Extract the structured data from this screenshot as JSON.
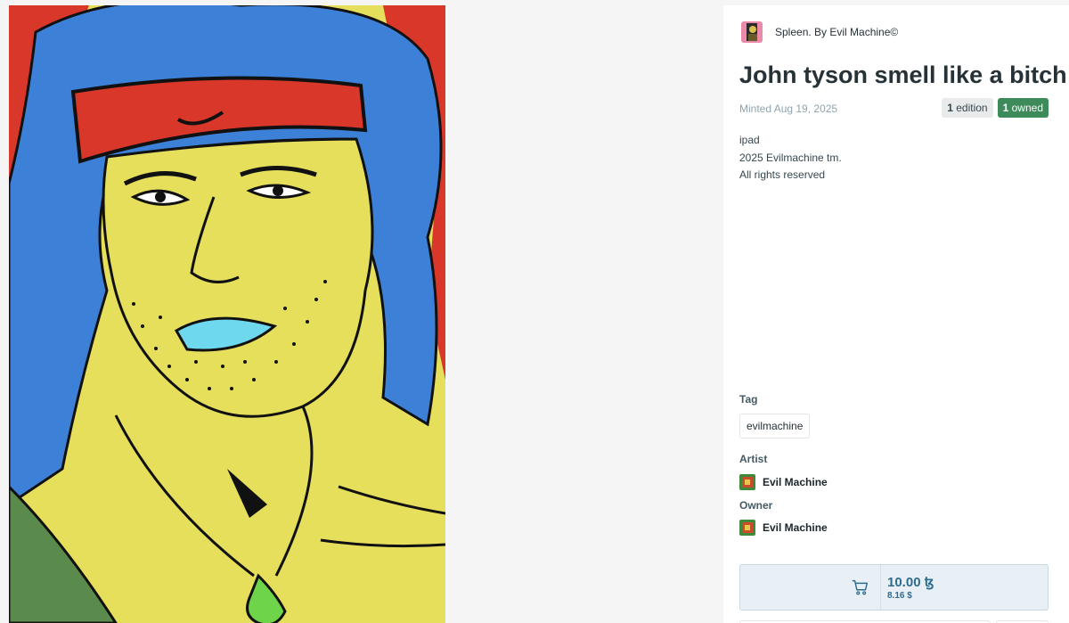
{
  "artwork": {
    "alt": "Colorful drawing of a man with long blue hair wearing a red headband"
  },
  "collection": {
    "name": "Spleen. By Evil Machine©"
  },
  "token": {
    "title": "John tyson smell like a bitch",
    "minted": "Minted Aug 19, 2025",
    "editions_count": "1",
    "editions_label": " edition",
    "owned_count": "1",
    "owned_label": " owned",
    "description_lines": [
      "ipad",
      "2025 Evilmachine tm.",
      "All rights reserved"
    ]
  },
  "tags": {
    "label": "Tag",
    "items": [
      "evilmachine"
    ]
  },
  "artist": {
    "label": "Artist",
    "name": "Evil Machine"
  },
  "owner": {
    "label": "Owner",
    "name": "Evil Machine"
  },
  "buy": {
    "price": "10.00 ꜩ",
    "price_usd": "8.16 $"
  },
  "colors": {
    "accent": "#2d6c8e",
    "owned_badge": "#3d8b5b",
    "buy_bg": "#e8f0f5"
  }
}
